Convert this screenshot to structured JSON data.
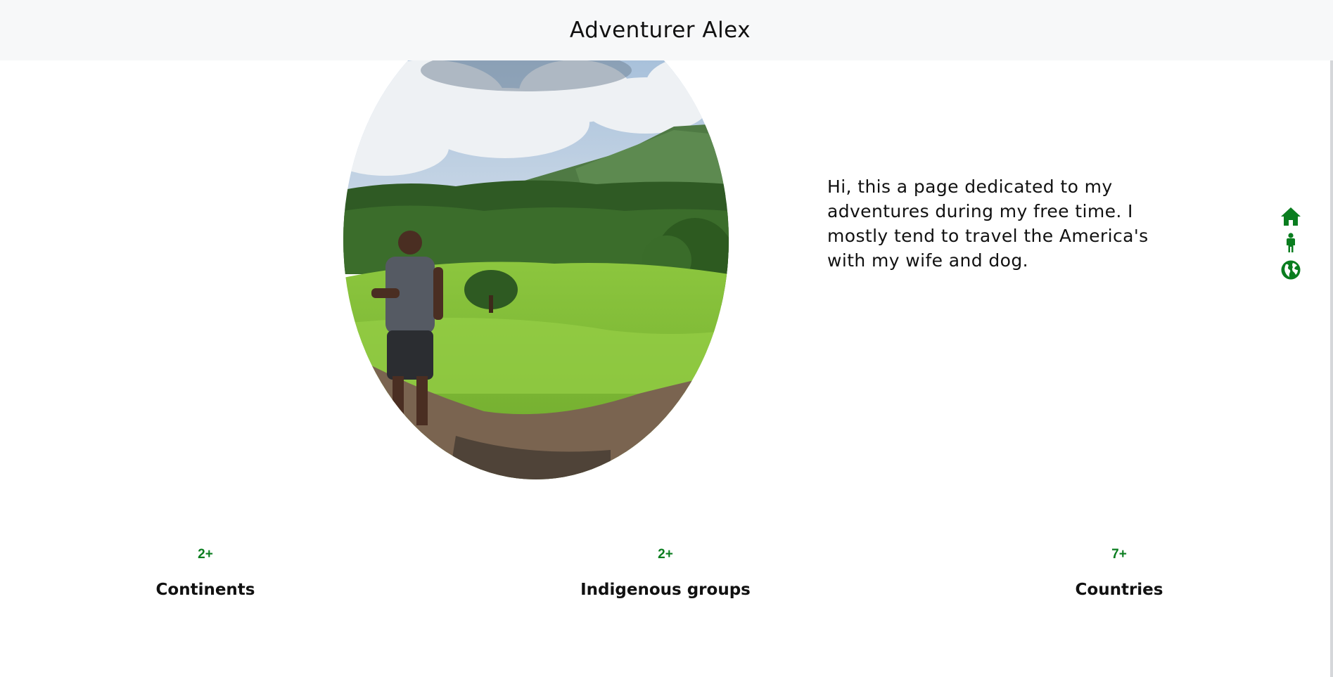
{
  "header": {
    "title": "Adventurer Alex"
  },
  "hero": {
    "photo_icon": "traveler-photo-volcano-landscape"
  },
  "intro": {
    "text": "Hi, this a page dedicated to my adventures during my free time. I mostly tend to travel the America's with my wife and dog."
  },
  "side_nav": {
    "items": [
      {
        "icon": "home-icon"
      },
      {
        "icon": "person-icon"
      },
      {
        "icon": "globe-icon"
      }
    ]
  },
  "stats": [
    {
      "value": "2+",
      "label": "Continents"
    },
    {
      "value": "2+",
      "label": "Indigenous groups"
    },
    {
      "value": "7+",
      "label": "Countries"
    }
  ],
  "colors": {
    "accent": "#0a7d1f",
    "header_bg": "#f7f8f9",
    "text": "#111111"
  }
}
